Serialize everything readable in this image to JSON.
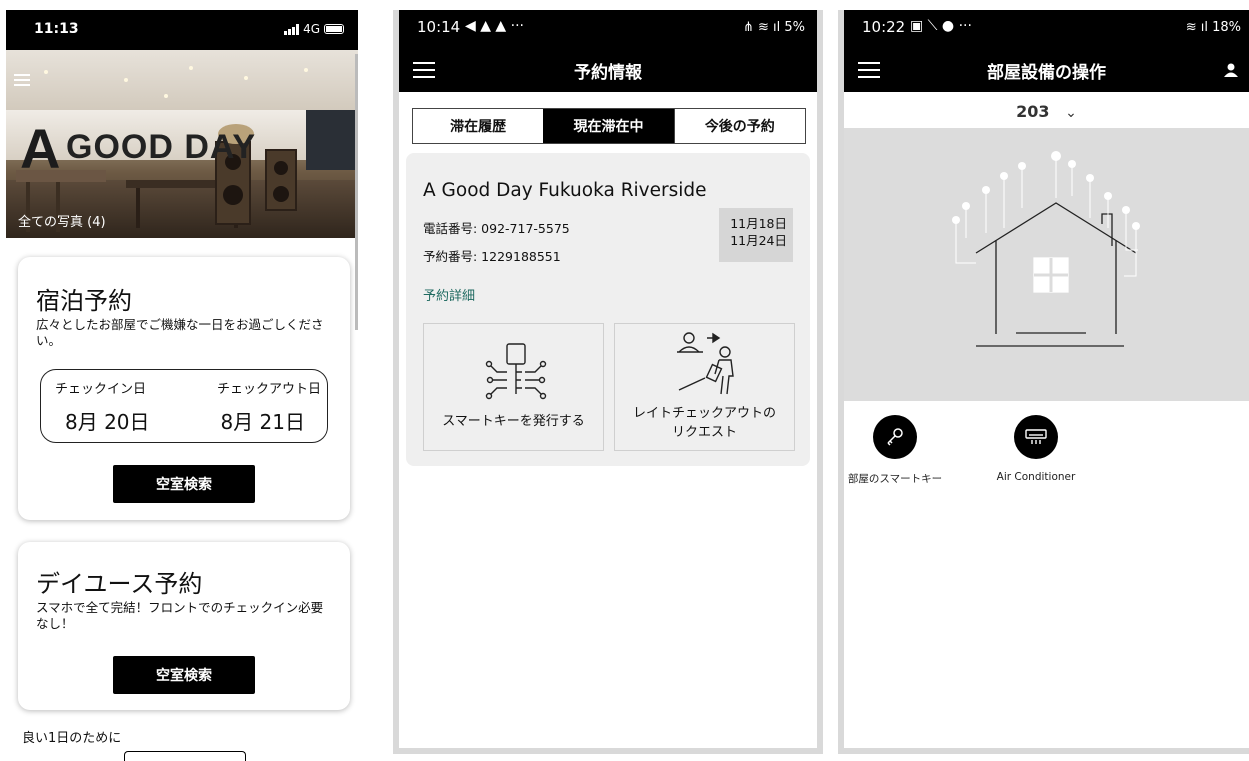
{
  "phone1": {
    "status": {
      "time": "11:13",
      "network": "4G"
    },
    "hero": {
      "sign_text": "GOOD DAY",
      "sign_letter": "A",
      "photos_label": "全ての写真 (4)"
    },
    "stay_card": {
      "title": "宿泊予約",
      "description": "広々としたお部屋でご機嫌な一日をお過ごしください。",
      "checkin_label": "チェックイン日",
      "checkout_label": "チェックアウト日",
      "checkin_value": "8月 20日",
      "checkout_value": "8月 21日",
      "search_button": "空室検索"
    },
    "dayuse_card": {
      "title": "デイユース予約",
      "description": "スマホで全て完結！フロントでのチェックイン必要なし！",
      "search_button": "空室検索"
    },
    "footer_text": "良い1日のために"
  },
  "phone2": {
    "status": {
      "time": "10:14",
      "right": "5%"
    },
    "title": "予約情報",
    "tabs": [
      {
        "label": "滞在履歴",
        "active": false
      },
      {
        "label": "現在滞在中",
        "active": true
      },
      {
        "label": "今後の予約",
        "active": false
      }
    ],
    "reservation": {
      "hotel": "A Good Day Fukuoka Riverside",
      "phone": "電話番号: 092-717-5575",
      "number": "予約番号: 1229188551",
      "date_in": "11月18日",
      "date_out": "11月24日",
      "detail_link": "予約詳細",
      "action_key": "スマートキーを発行する",
      "action_late_1": "レイトチェックアウトの",
      "action_late_2": "リクエスト"
    }
  },
  "phone3": {
    "status": {
      "time": "10:22",
      "right": "18%"
    },
    "title": "部屋設備の操作",
    "room": "203",
    "devices": [
      {
        "name": "部屋のスマートキー",
        "icon": "key-icon"
      },
      {
        "name": "Air Conditioner",
        "icon": "air-conditioner-icon"
      }
    ]
  },
  "colors": {
    "accent_link": "#1f6a60",
    "primary": "#000000"
  }
}
